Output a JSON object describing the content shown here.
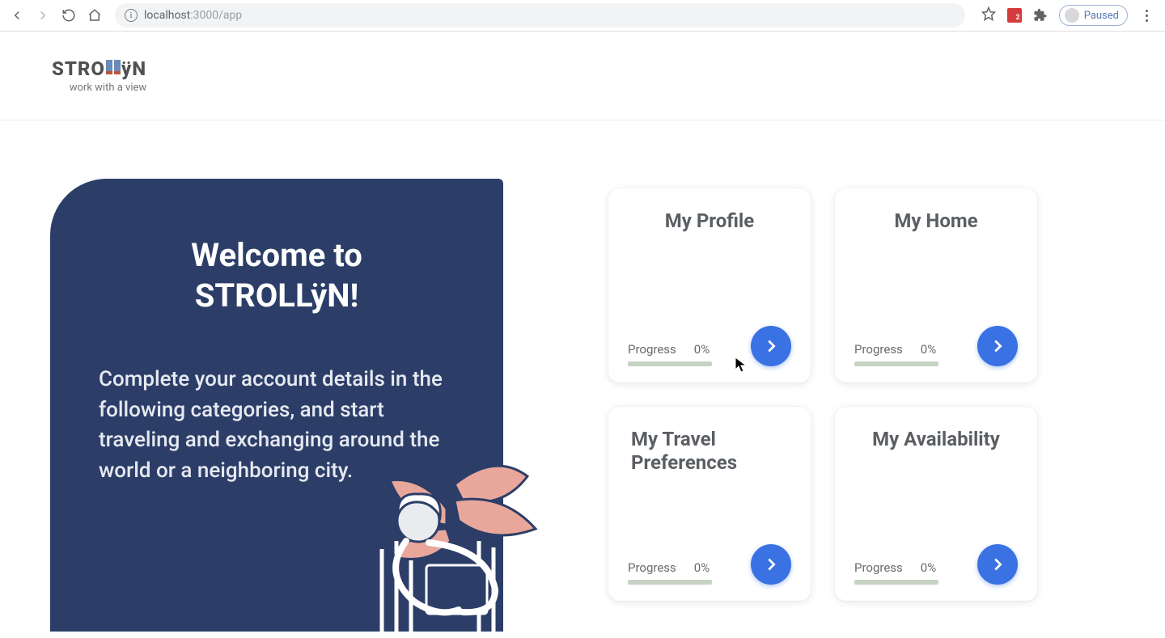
{
  "browser": {
    "url_host": "localhost",
    "url_port_path": ":3000/app",
    "paused_label": "Paused",
    "ext_badge": "2"
  },
  "app_header": {
    "logo_pre": "STRO",
    "logo_post": "ÿN",
    "tagline": "work with a view"
  },
  "welcome": {
    "title_line1": "Welcome to",
    "title_line2": "STROLLÿN!",
    "body": "Complete your account details in the following categories, and start traveling and exchanging around the world or a neighboring city."
  },
  "cards": [
    {
      "title": "My Profile",
      "progress_label": "Progress",
      "progress_value": "0%"
    },
    {
      "title": "My Home",
      "progress_label": "Progress",
      "progress_value": "0%"
    },
    {
      "title": "My Travel Preferences",
      "progress_label": "Progress",
      "progress_value": "0%"
    },
    {
      "title": "My Availability",
      "progress_label": "Progress",
      "progress_value": "0%"
    }
  ]
}
